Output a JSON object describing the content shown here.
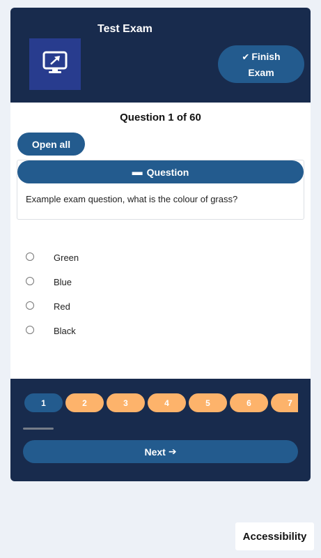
{
  "header": {
    "title": "Test Exam",
    "logo_icon": "monitor-arrow-icon",
    "finish_button": {
      "icon": "check-icon",
      "line1": "Finish",
      "line2": "Exam"
    }
  },
  "question_counter": "Question 1 of 60",
  "open_all_label": "Open all",
  "question_panel": {
    "toggle_icon": "minus-icon",
    "heading": "Question",
    "text": "Example exam question, what is the colour of grass?"
  },
  "options": [
    {
      "label": "Green"
    },
    {
      "label": "Blue"
    },
    {
      "label": "Red"
    },
    {
      "label": "Black"
    }
  ],
  "pagination": {
    "current": "1",
    "pages": [
      "1",
      "2",
      "3",
      "4",
      "5",
      "6",
      "7"
    ]
  },
  "next_button": {
    "label": "Next",
    "icon": "arrow-right-icon"
  },
  "accessibility_label": "Accessibility",
  "colors": {
    "navy": "#182b4d",
    "accent_blue": "#235b8e",
    "logo_blue": "#283c8e",
    "page_pill_orange": "#fdb36b",
    "background": "#edf1f7"
  }
}
